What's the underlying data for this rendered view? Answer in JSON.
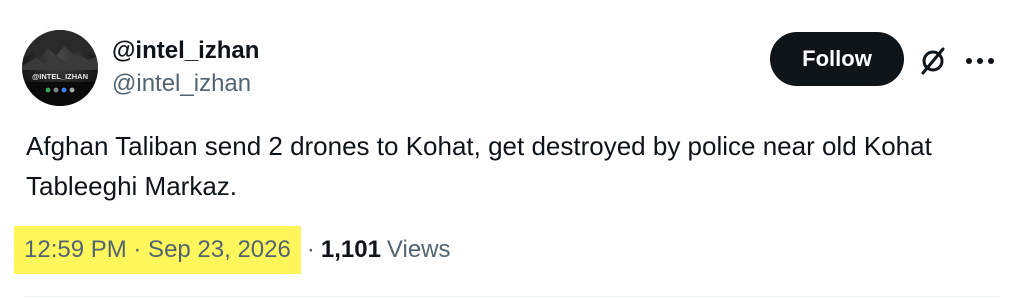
{
  "author": {
    "display_name": "@intel_izhan",
    "handle": "@intel_izhan",
    "avatar_text": "@INTEL_IZHAN"
  },
  "actions": {
    "follow_label": "Follow",
    "grok_icon": "slashed-circle-icon",
    "more_icon": "more-horizontal-icon"
  },
  "tweet": {
    "text": "Afghan Taliban send 2 drones to Kohat, get destroyed by police near old Kohat Tableeghi Markaz.",
    "timestamp": "12:59 PM · Sep 23, 2026",
    "separator": "·",
    "view_count": "1,101",
    "views_label": "Views"
  },
  "colors": {
    "primary_text": "#0f1419",
    "secondary_text": "#536471",
    "highlight": "#fef65b",
    "follow_bg": "#0f1419"
  }
}
